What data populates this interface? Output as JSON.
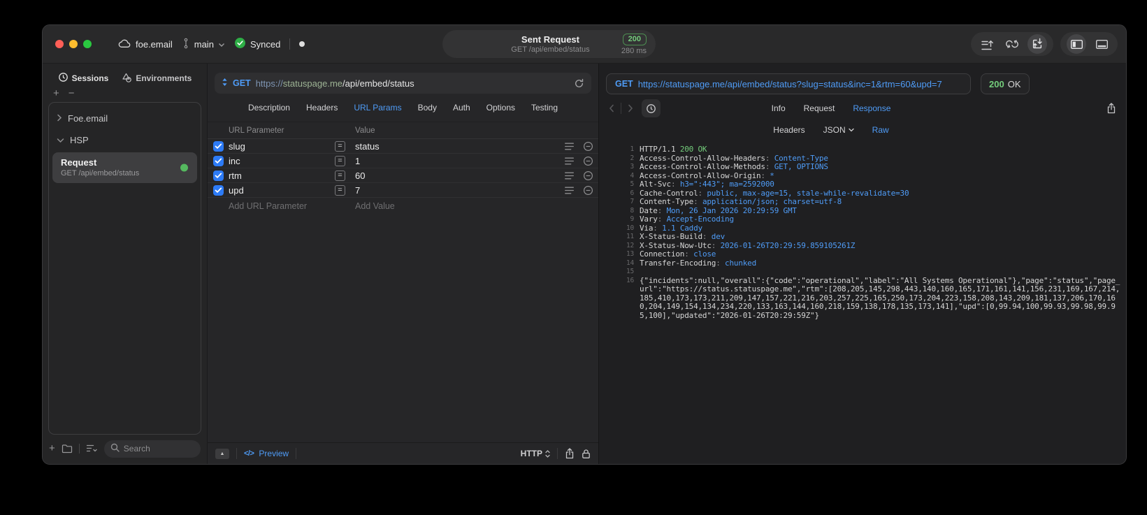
{
  "colors": {
    "accent_blue": "#4F9CF7",
    "success_green": "#74CD7C",
    "checkbox_blue": "#2D7BF6",
    "status_dot_green": "#55B95F"
  },
  "titlebar": {
    "workspace": "foe.email",
    "branch": "main",
    "sync_label": "Synced",
    "request_title": "Sent Request",
    "request_subtitle": "GET /api/embed/status",
    "status_code": "200",
    "duration": "280 ms"
  },
  "sidebar": {
    "tabs": {
      "sessions": "Sessions",
      "environments": "Environments"
    },
    "tree": {
      "group1": "Foe.email",
      "group2": "HSP"
    },
    "request_item": {
      "title": "Request",
      "subtitle": "GET /api/embed/status"
    },
    "search_placeholder": "Search"
  },
  "request_editor": {
    "method": "GET",
    "url": {
      "scheme": "https://",
      "host": "statuspage.me",
      "path": "/api/embed/status"
    },
    "tabs": [
      "Description",
      "Headers",
      "URL Params",
      "Body",
      "Auth",
      "Options",
      "Testing"
    ],
    "active_tab": "URL Params",
    "params": {
      "columns": {
        "name": "URL Parameter",
        "value": "Value"
      },
      "eq": "=",
      "rows": [
        {
          "enabled": true,
          "name": "slug",
          "value": "status"
        },
        {
          "enabled": true,
          "name": "inc",
          "value": "1"
        },
        {
          "enabled": true,
          "name": "rtm",
          "value": "60"
        },
        {
          "enabled": true,
          "name": "upd",
          "value": "7"
        }
      ],
      "add_name": "Add URL Parameter",
      "add_value": "Add Value"
    },
    "footer": {
      "preview": "Preview",
      "code_glyph": "</>",
      "protocol": "HTTP"
    }
  },
  "response_viewer": {
    "method": "GET",
    "url": "https://statuspage.me/api/embed/status?slug=status&inc=1&rtm=60&upd=7",
    "status_code": "200",
    "status_text": "OK",
    "tabs": [
      "Info",
      "Request",
      "Response"
    ],
    "active_tab": "Response",
    "subtabs": [
      "Headers",
      "JSON",
      "Raw"
    ],
    "active_subtab": "Raw",
    "body_lines": [
      {
        "n": "1",
        "parts": [
          [
            "p",
            "HTTP/1.1 "
          ],
          [
            "g",
            "200 OK"
          ]
        ]
      },
      {
        "n": "2",
        "parts": [
          [
            "k",
            "Access-Control-Allow-Headers"
          ],
          [
            "c",
            ": "
          ],
          [
            "v",
            "Content-Type"
          ]
        ]
      },
      {
        "n": "3",
        "parts": [
          [
            "k",
            "Access-Control-Allow-Methods"
          ],
          [
            "c",
            ": "
          ],
          [
            "v",
            "GET, OPTIONS"
          ]
        ]
      },
      {
        "n": "4",
        "parts": [
          [
            "k",
            "Access-Control-Allow-Origin"
          ],
          [
            "c",
            ": "
          ],
          [
            "v",
            "*"
          ]
        ]
      },
      {
        "n": "5",
        "parts": [
          [
            "k",
            "Alt-Svc"
          ],
          [
            "c",
            ": "
          ],
          [
            "v",
            "h3=\":443\"; ma=2592000"
          ]
        ]
      },
      {
        "n": "6",
        "parts": [
          [
            "k",
            "Cache-Control"
          ],
          [
            "c",
            ": "
          ],
          [
            "v",
            "public, max-age=15, stale-while-revalidate=30"
          ]
        ]
      },
      {
        "n": "7",
        "parts": [
          [
            "k",
            "Content-Type"
          ],
          [
            "c",
            ": "
          ],
          [
            "v",
            "application/json; charset=utf-8"
          ]
        ]
      },
      {
        "n": "8",
        "parts": [
          [
            "k",
            "Date"
          ],
          [
            "c",
            ": "
          ],
          [
            "v",
            "Mon, 26 Jan 2026 20:29:59 GMT"
          ]
        ]
      },
      {
        "n": "9",
        "parts": [
          [
            "k",
            "Vary"
          ],
          [
            "c",
            ": "
          ],
          [
            "v",
            "Accept-Encoding"
          ]
        ]
      },
      {
        "n": "10",
        "parts": [
          [
            "k",
            "Via"
          ],
          [
            "c",
            ": "
          ],
          [
            "v",
            "1.1 Caddy"
          ]
        ]
      },
      {
        "n": "11",
        "parts": [
          [
            "k",
            "X-Status-Build"
          ],
          [
            "c",
            ": "
          ],
          [
            "v",
            "dev"
          ]
        ]
      },
      {
        "n": "12",
        "parts": [
          [
            "k",
            "X-Status-Now-Utc"
          ],
          [
            "c",
            ": "
          ],
          [
            "v",
            "2026-01-26T20:29:59.859105261Z"
          ]
        ]
      },
      {
        "n": "13",
        "parts": [
          [
            "k",
            "Connection"
          ],
          [
            "c",
            ": "
          ],
          [
            "v",
            "close"
          ]
        ]
      },
      {
        "n": "14",
        "parts": [
          [
            "k",
            "Transfer-Encoding"
          ],
          [
            "c",
            ": "
          ],
          [
            "v",
            "chunked"
          ]
        ]
      },
      {
        "n": "15",
        "parts": []
      },
      {
        "n": "16",
        "parts": [
          [
            "p",
            "{\"incidents\":null,\"overall\":{\"code\":\"operational\",\"label\":\"All Systems Operational\"},\"page\":\"status\",\"page_url\":\"https://status.statuspage.me\",\"rtm\":[208,205,145,298,443,140,160,165,171,161,141,156,231,169,167,214,185,410,173,173,211,209,147,157,221,216,203,257,225,165,250,173,204,223,158,208,143,209,181,137,206,170,160,204,149,154,134,234,220,133,163,144,160,218,159,138,178,135,173,141],\"upd\":[0,99.94,100,99.93,99.98,99.95,100],\"updated\":\"2026-01-26T20:29:59Z\"}"
          ]
        ]
      }
    ]
  }
}
